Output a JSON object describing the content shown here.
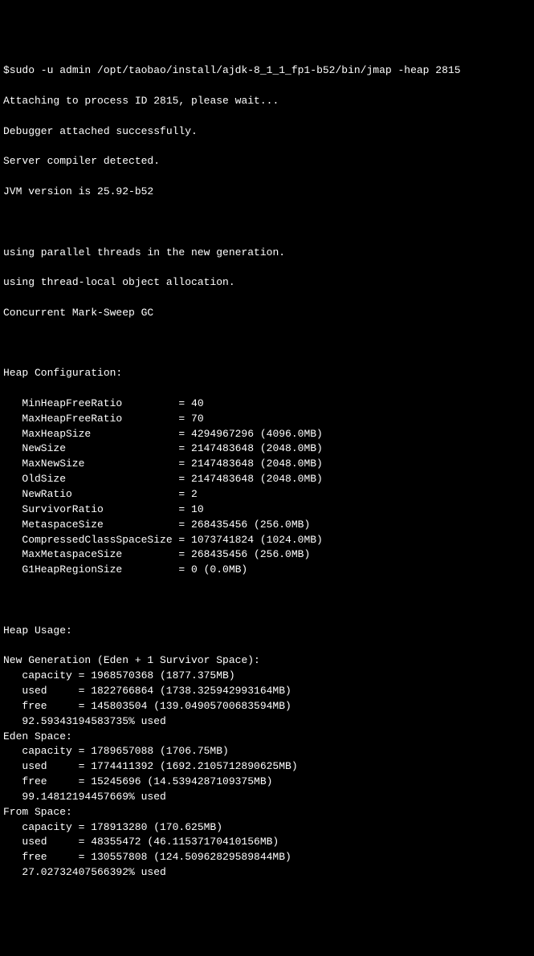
{
  "command": "$sudo -u admin /opt/taobao/install/ajdk-8_1_1_fp1-b52/bin/jmap -heap 2815",
  "messages": {
    "attaching": "Attaching to process ID 2815, please wait...",
    "debugger": "Debugger attached successfully.",
    "server": "Server compiler detected.",
    "jvm_version": "JVM version is 25.92-b52",
    "parallel_threads": "using parallel threads in the new generation.",
    "thread_local": "using thread-local object allocation.",
    "gc": "Concurrent Mark-Sweep GC"
  },
  "heap_config": {
    "title": "Heap Configuration:",
    "rows": [
      {
        "key": "MinHeapFreeRatio",
        "val": "= 40"
      },
      {
        "key": "MaxHeapFreeRatio",
        "val": "= 70"
      },
      {
        "key": "MaxHeapSize",
        "val": "= 4294967296 (4096.0MB)"
      },
      {
        "key": "NewSize",
        "val": "= 2147483648 (2048.0MB)"
      },
      {
        "key": "MaxNewSize",
        "val": "= 2147483648 (2048.0MB)"
      },
      {
        "key": "OldSize",
        "val": "= 2147483648 (2048.0MB)"
      },
      {
        "key": "NewRatio",
        "val": "= 2"
      },
      {
        "key": "SurvivorRatio",
        "val": "= 10"
      },
      {
        "key": "MetaspaceSize",
        "val": "= 268435456 (256.0MB)"
      },
      {
        "key": "CompressedClassSpaceSize",
        "val": "= 1073741824 (1024.0MB)"
      },
      {
        "key": "MaxMetaspaceSize",
        "val": "= 268435456 (256.0MB)"
      },
      {
        "key": "G1HeapRegionSize",
        "val": "= 0 (0.0MB)"
      }
    ]
  },
  "heap_usage": {
    "title": "Heap Usage:",
    "sections": [
      {
        "title": "New Generation (Eden + 1 Survivor Space):",
        "rows": [
          {
            "key": "capacity",
            "val": "= 1968570368 (1877.375MB)"
          },
          {
            "key": "used",
            "val": "= 1822766864 (1738.325942993164MB)"
          },
          {
            "key": "free",
            "val": "= 145803504 (139.04905700683594MB)"
          }
        ],
        "percent": "92.59343194583735% used"
      },
      {
        "title": "Eden Space:",
        "rows": [
          {
            "key": "capacity",
            "val": "= 1789657088 (1706.75MB)"
          },
          {
            "key": "used",
            "val": "= 1774411392 (1692.2105712890625MB)"
          },
          {
            "key": "free",
            "val": "= 15245696 (14.5394287109375MB)"
          }
        ],
        "percent": "99.14812194457669% used"
      },
      {
        "title": "From Space:",
        "rows": [
          {
            "key": "capacity",
            "val": "= 178913280 (170.625MB)"
          },
          {
            "key": "used",
            "val": "= 48355472 (46.11537170410156MB)"
          },
          {
            "key": "free",
            "val": "= 130557808 (124.50962829589844MB)"
          }
        ],
        "percent": "27.02732407566392% used"
      }
    ]
  }
}
